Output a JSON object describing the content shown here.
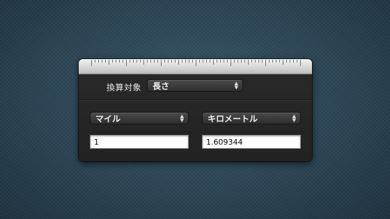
{
  "converter": {
    "target_label": "換算対象",
    "target_value": "長さ",
    "from_unit": "マイル",
    "to_unit": "キロメートル",
    "from_value": "1",
    "to_value": "1.609344"
  },
  "icons": {
    "popup_arrows": "up-down-arrows-icon",
    "ruler": "ruler-graphic"
  },
  "colors": {
    "panel": "#262626",
    "background": "#2d4656"
  }
}
